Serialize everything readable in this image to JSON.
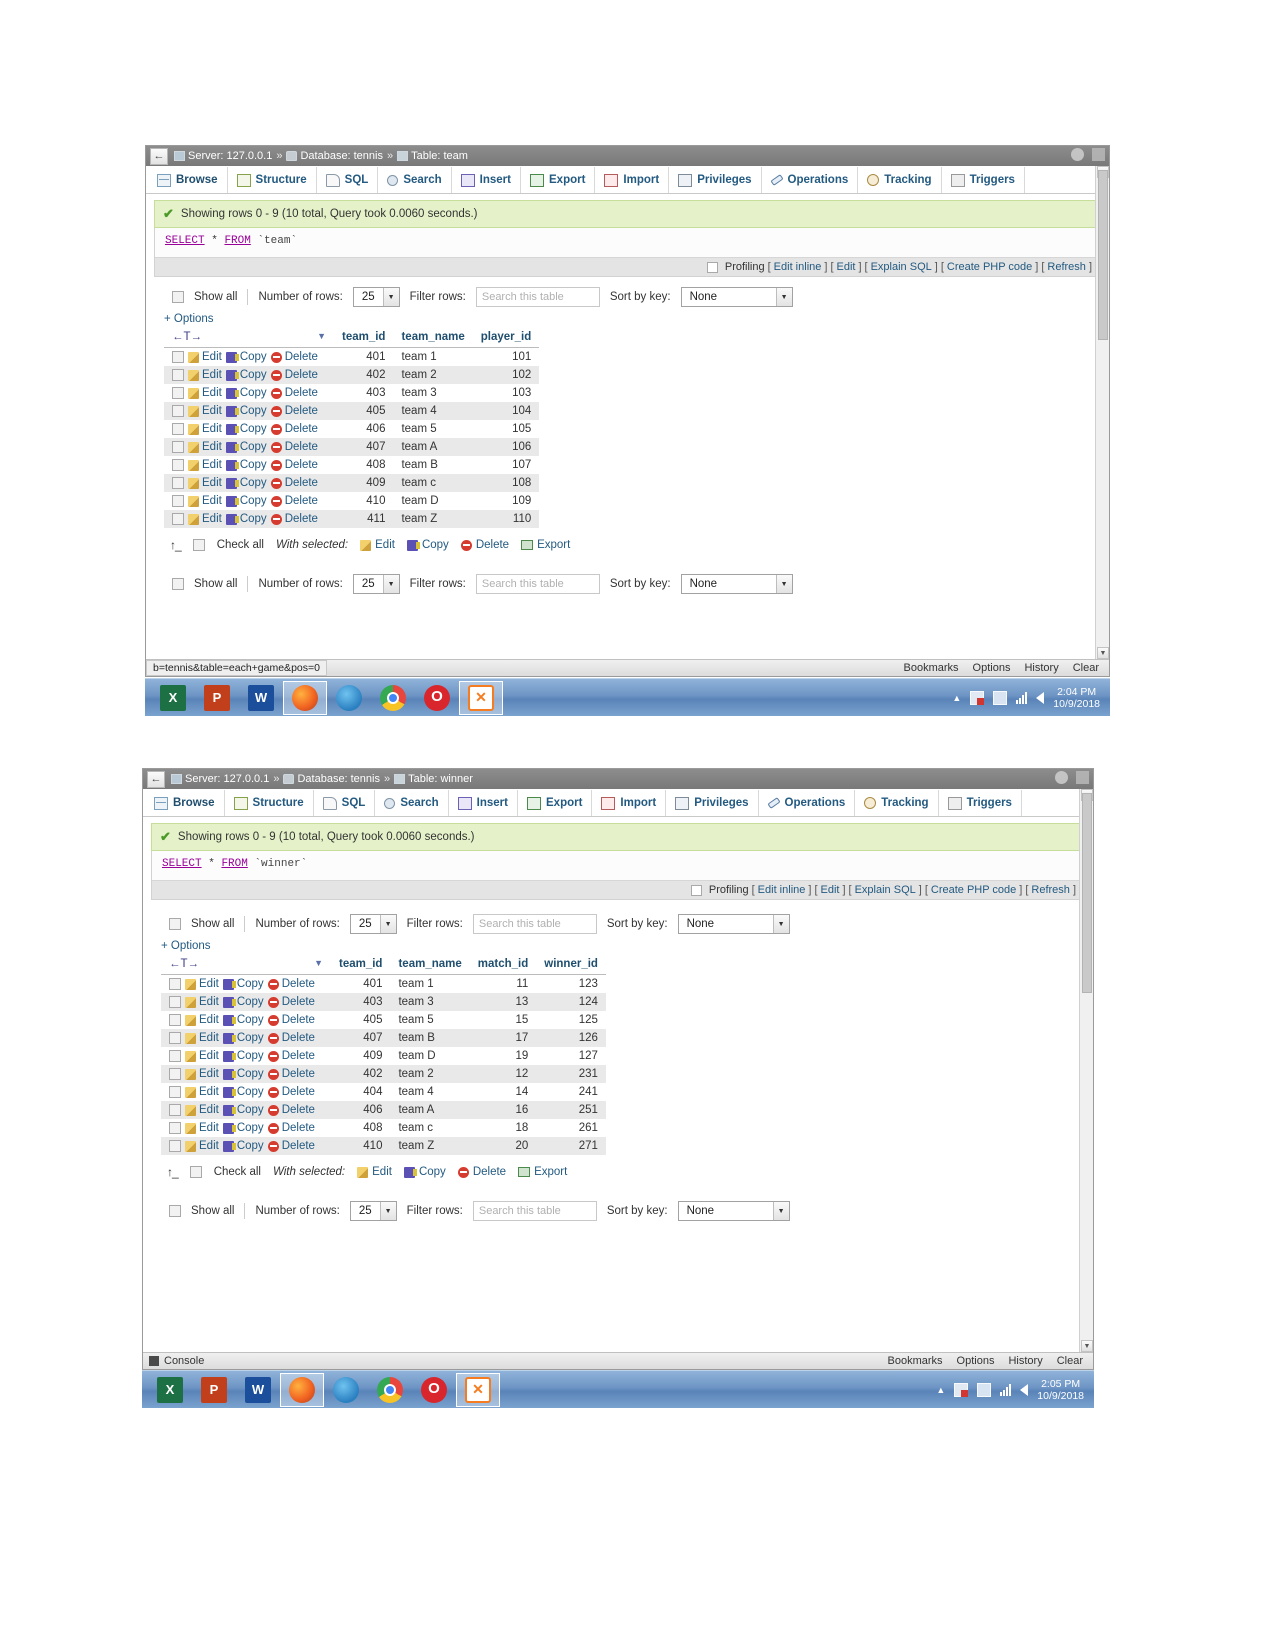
{
  "panels": [
    {
      "breadcrumb": {
        "server_label": "Server:",
        "server_value": "127.0.0.1",
        "db_label": "Database:",
        "db_value": "tennis",
        "table_label": "Table:",
        "table_value": "team",
        "separator": "»",
        "back_arrow": "←"
      },
      "tabs": [
        {
          "label": "Browse",
          "icon": "browse-grid-icon",
          "active": true
        },
        {
          "label": "Structure",
          "icon": "structure-icon",
          "active": false
        },
        {
          "label": "SQL",
          "icon": "sql-page-icon",
          "active": false
        },
        {
          "label": "Search",
          "icon": "search-magnifier-icon",
          "active": false
        },
        {
          "label": "Insert",
          "icon": "insert-icon",
          "active": false
        },
        {
          "label": "Export",
          "icon": "export-icon",
          "active": false
        },
        {
          "label": "Import",
          "icon": "import-icon",
          "active": false
        },
        {
          "label": "Privileges",
          "icon": "privileges-icon",
          "active": false
        },
        {
          "label": "Operations",
          "icon": "operations-wrench-icon",
          "active": false
        },
        {
          "label": "Tracking",
          "icon": "tracking-eye-icon",
          "active": false
        },
        {
          "label": "Triggers",
          "icon": "triggers-icon",
          "active": false
        }
      ],
      "status_message": "Showing rows 0 - 9 (10 total, Query took 0.0060 seconds.)",
      "sql": {
        "keyword1": "SELECT",
        "star": "*",
        "keyword2": "FROM",
        "table": "`team`"
      },
      "sql_footer": {
        "profiling": "Profiling",
        "links": [
          "Edit inline",
          "Edit",
          "Explain SQL",
          "Create PHP code",
          "Refresh"
        ]
      },
      "controls": {
        "show_all": "Show all",
        "number_of_rows_label": "Number of rows:",
        "number_of_rows_value": "25",
        "filter_rows_label": "Filter rows:",
        "filter_rows_placeholder": "Search this table",
        "sort_by_key_label": "Sort by key:",
        "sort_by_key_value": "None"
      },
      "options_link": "+ Options",
      "table": {
        "sort_header": "←T→",
        "columns": [
          "team_id",
          "team_name",
          "player_id"
        ],
        "row_actions": [
          "Edit",
          "Copy",
          "Delete"
        ],
        "rows": [
          [
            "401",
            "team 1",
            "101"
          ],
          [
            "402",
            "team 2",
            "102"
          ],
          [
            "403",
            "team 3",
            "103"
          ],
          [
            "405",
            "team 4",
            "104"
          ],
          [
            "406",
            "team 5",
            "105"
          ],
          [
            "407",
            "team A",
            "106"
          ],
          [
            "408",
            "team B",
            "107"
          ],
          [
            "409",
            "team c",
            "108"
          ],
          [
            "410",
            "team D",
            "109"
          ],
          [
            "411",
            "team Z",
            "110"
          ]
        ]
      },
      "with_selected": {
        "check_all": "Check all",
        "label": "With selected:",
        "actions": [
          "Edit",
          "Copy",
          "Delete",
          "Export"
        ]
      },
      "statusbar": {
        "url_hint": "b=tennis&table=each+game&pos=0",
        "links": [
          "Bookmarks",
          "Options",
          "History",
          "Clear"
        ]
      },
      "taskbar": {
        "apps": [
          "excel-icon",
          "powerpoint-icon",
          "word-icon",
          "firefox-icon",
          "thunderbird-icon",
          "chrome-icon",
          "opera-icon",
          "xampp-icon"
        ],
        "time": "2:04 PM",
        "date": "10/9/2018"
      }
    },
    {
      "breadcrumb": {
        "server_label": "Server:",
        "server_value": "127.0.0.1",
        "db_label": "Database:",
        "db_value": "tennis",
        "table_label": "Table:",
        "table_value": "winner",
        "separator": "»",
        "back_arrow": "←"
      },
      "tabs": [
        {
          "label": "Browse",
          "icon": "browse-grid-icon",
          "active": true
        },
        {
          "label": "Structure",
          "icon": "structure-icon",
          "active": false
        },
        {
          "label": "SQL",
          "icon": "sql-page-icon",
          "active": false
        },
        {
          "label": "Search",
          "icon": "search-magnifier-icon",
          "active": false
        },
        {
          "label": "Insert",
          "icon": "insert-icon",
          "active": false
        },
        {
          "label": "Export",
          "icon": "export-icon",
          "active": false
        },
        {
          "label": "Import",
          "icon": "import-icon",
          "active": false
        },
        {
          "label": "Privileges",
          "icon": "privileges-icon",
          "active": false
        },
        {
          "label": "Operations",
          "icon": "operations-wrench-icon",
          "active": false
        },
        {
          "label": "Tracking",
          "icon": "tracking-eye-icon",
          "active": false
        },
        {
          "label": "Triggers",
          "icon": "triggers-icon",
          "active": false
        }
      ],
      "status_message": "Showing rows 0 - 9 (10 total, Query took 0.0060 seconds.)",
      "sql": {
        "keyword1": "SELECT",
        "star": "*",
        "keyword2": "FROM",
        "table": "`winner`"
      },
      "sql_footer": {
        "profiling": "Profiling",
        "links": [
          "Edit inline",
          "Edit",
          "Explain SQL",
          "Create PHP code",
          "Refresh"
        ]
      },
      "controls": {
        "show_all": "Show all",
        "number_of_rows_label": "Number of rows:",
        "number_of_rows_value": "25",
        "filter_rows_label": "Filter rows:",
        "filter_rows_placeholder": "Search this table",
        "sort_by_key_label": "Sort by key:",
        "sort_by_key_value": "None"
      },
      "options_link": "+ Options",
      "table": {
        "sort_header": "←T→",
        "columns": [
          "team_id",
          "team_name",
          "match_id",
          "winner_id"
        ],
        "row_actions": [
          "Edit",
          "Copy",
          "Delete"
        ],
        "rows": [
          [
            "401",
            "team 1",
            "11",
            "123"
          ],
          [
            "403",
            "team 3",
            "13",
            "124"
          ],
          [
            "405",
            "team 5",
            "15",
            "125"
          ],
          [
            "407",
            "team B",
            "17",
            "126"
          ],
          [
            "409",
            "team D",
            "19",
            "127"
          ],
          [
            "402",
            "team 2",
            "12",
            "231"
          ],
          [
            "404",
            "team 4",
            "14",
            "241"
          ],
          [
            "406",
            "team A",
            "16",
            "251"
          ],
          [
            "408",
            "team c",
            "18",
            "261"
          ],
          [
            "410",
            "team Z",
            "20",
            "271"
          ]
        ]
      },
      "with_selected": {
        "check_all": "Check all",
        "label": "With selected:",
        "actions": [
          "Edit",
          "Copy",
          "Delete",
          "Export"
        ]
      },
      "statusbar": {
        "console_label": "Console",
        "links": [
          "Bookmarks",
          "Options",
          "History",
          "Clear"
        ]
      },
      "taskbar": {
        "apps": [
          "excel-icon",
          "powerpoint-icon",
          "word-icon",
          "firefox-icon",
          "thunderbird-icon",
          "chrome-icon",
          "opera-icon",
          "xampp-icon"
        ],
        "time": "2:05 PM",
        "date": "10/9/2018"
      }
    }
  ]
}
